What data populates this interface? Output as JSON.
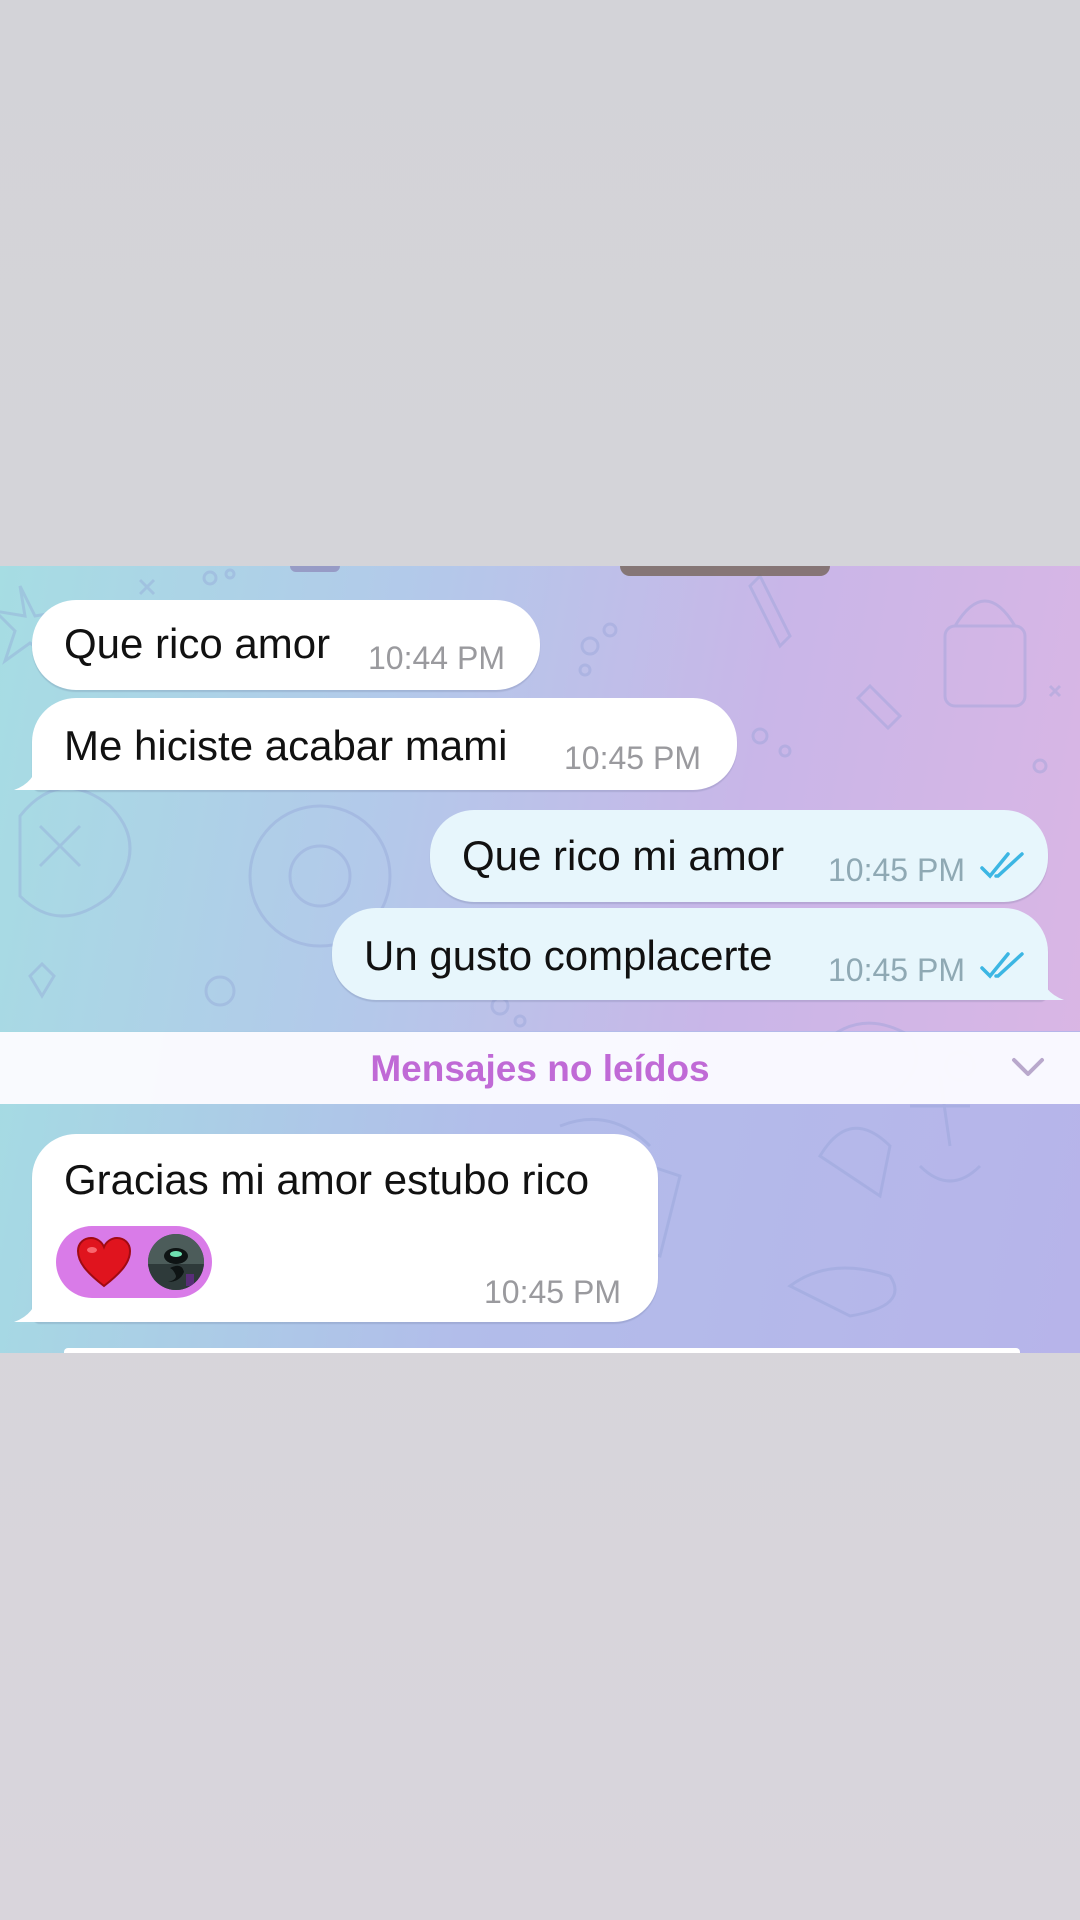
{
  "colors": {
    "incoming_bubble": "#ffffff",
    "outgoing_bubble": "#e7f6fc",
    "read_check": "#3cb6e3",
    "unread_label": "#c06ad6",
    "reaction_pill": "#d97be8"
  },
  "messages": [
    {
      "direction": "incoming",
      "text": "Que rico amor",
      "time": "10:44 PM"
    },
    {
      "direction": "incoming",
      "text": "Me hiciste acabar mami",
      "time": "10:45 PM"
    },
    {
      "direction": "outgoing",
      "text": "Que rico mi amor",
      "time": "10:45 PM",
      "status_icon": "double-check-icon"
    },
    {
      "direction": "outgoing",
      "text": "Un gusto complacerte",
      "time": "10:45 PM",
      "status_icon": "double-check-icon"
    }
  ],
  "unread_divider": {
    "label": "Mensajes no leídos",
    "icon": "chevron-down-icon"
  },
  "unread_messages": [
    {
      "direction": "incoming",
      "text": "Gracias mi amor estubo rico",
      "time": "10:45 PM",
      "reactions": [
        {
          "icon": "red-heart-icon"
        },
        {
          "icon": "reactor-avatar"
        }
      ]
    }
  ]
}
